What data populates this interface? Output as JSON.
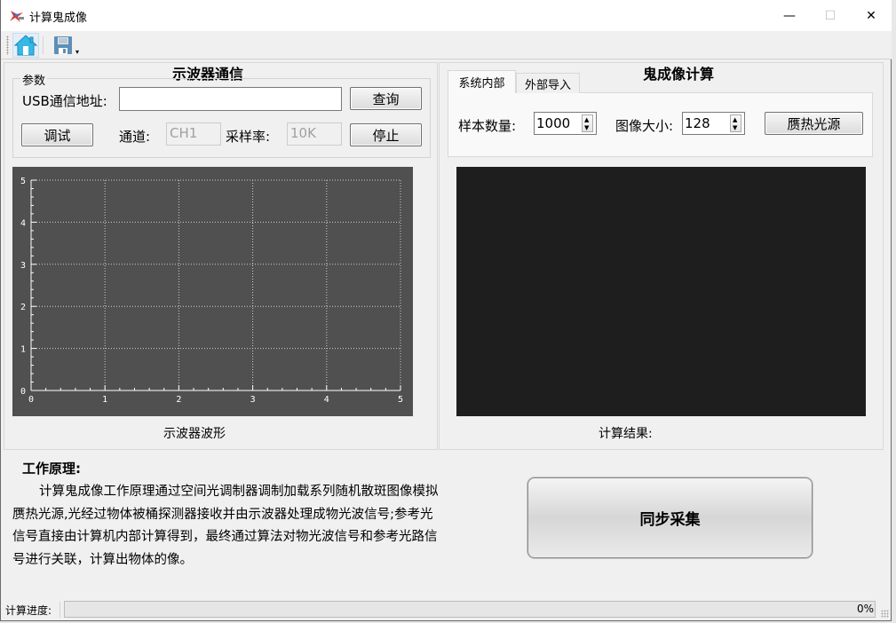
{
  "window": {
    "title": "计算鬼成像",
    "controls": {
      "minimize": "—",
      "maximize": "☐",
      "close": "✕"
    }
  },
  "toolbar": {
    "items": [
      {
        "name": "home",
        "icon": "home-icon"
      },
      {
        "name": "save",
        "icon": "save-icon",
        "dropdown": "▾"
      }
    ]
  },
  "oscilloscope": {
    "heading": "示波器通信",
    "group_label": "参数",
    "usb_label": "USB通信地址:",
    "usb_value": "",
    "query_button": "查询",
    "debug_button": "调试",
    "channel_label": "通道:",
    "channel_value": "CH1",
    "sample_rate_label": "采样率:",
    "sample_rate_value": "10K",
    "stop_button": "停止",
    "waveform_caption": "示波器波形"
  },
  "ghost_imaging": {
    "heading": "鬼成像计算",
    "tabs": [
      {
        "label": "系统内部",
        "active": true
      },
      {
        "label": "外部导入",
        "active": false
      }
    ],
    "sample_count_label": "样本数量:",
    "sample_count_value": "1000",
    "image_size_label": "图像大小:",
    "image_size_value": "128",
    "pseudo_thermal_button": "赝热光源",
    "result_caption": "计算结果:"
  },
  "description": {
    "title": "工作原理:",
    "text": "计算鬼成像工作原理通过空间光调制器调制加载系列随机散斑图像模拟赝热光源,光经过物体被桶探测器接收并由示波器处理成物光波信号;参考光信号直接由计算机内部计算得到，最终通过算法对物光波信号和参考光路信号进行关联，计算出物体的像。"
  },
  "sync_button": "同步采集",
  "status": {
    "progress_label": "计算进度:",
    "progress_value": 0,
    "progress_text": "0%"
  },
  "chart_data": {
    "type": "line",
    "title": "",
    "xlabel": "",
    "ylabel": "",
    "xlim": [
      0,
      5
    ],
    "ylim": [
      0,
      5
    ],
    "x_ticks": [
      "0",
      "1",
      "2",
      "3",
      "4",
      "5"
    ],
    "y_ticks": [
      "0",
      "1",
      "2",
      "3",
      "4",
      "5"
    ],
    "grid": true,
    "series": [],
    "colors": {
      "background": "#505050",
      "axis": "#ffffff",
      "grid": "#d0d0d0"
    }
  }
}
